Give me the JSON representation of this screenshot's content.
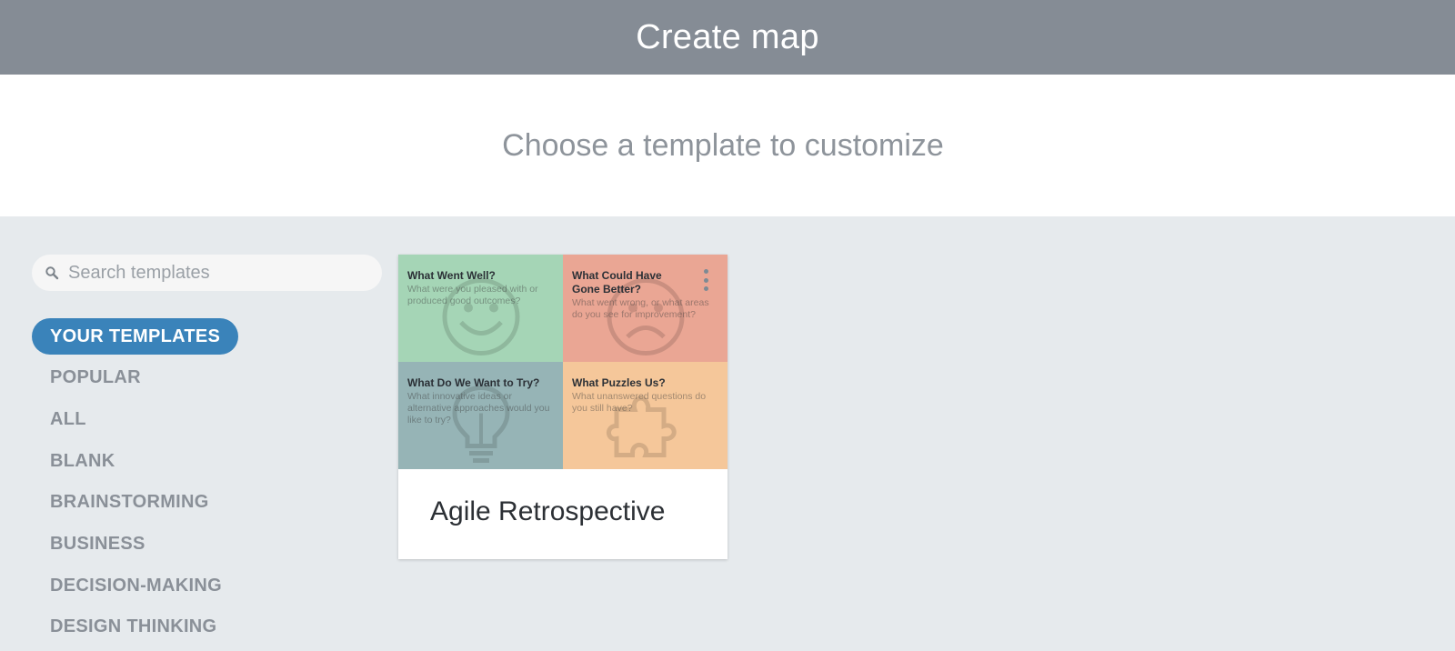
{
  "header": {
    "title": "Create map"
  },
  "subheader": {
    "title": "Choose a template to customize"
  },
  "search": {
    "placeholder": "Search templates",
    "value": ""
  },
  "categories": [
    {
      "label": "YOUR TEMPLATES",
      "active": true
    },
    {
      "label": "POPULAR"
    },
    {
      "label": "ALL"
    },
    {
      "label": "BLANK"
    },
    {
      "label": "BRAINSTORMING"
    },
    {
      "label": "BUSINESS"
    },
    {
      "label": "DECISION-MAKING"
    },
    {
      "label": "DESIGN THINKING"
    }
  ],
  "templates": [
    {
      "title": "Agile Retrospective",
      "quadrants": [
        {
          "title": "What Went Well?",
          "desc": "What were you pleased with or produced good outcomes?",
          "color": "#a5d5b6",
          "icon": "smile-icon"
        },
        {
          "title": "What Could Have Gone Better?",
          "desc": "What went wrong, or what areas do you see for improvement?",
          "color": "#eaa694",
          "icon": "frown-icon"
        },
        {
          "title": "What Do We Want to Try?",
          "desc": "What innovative ideas or alternative approaches would you like to try?",
          "color": "#96b4b6",
          "icon": "lightbulb-icon"
        },
        {
          "title": "What Puzzles Us?",
          "desc": "What unanswered questions do you still have?",
          "color": "#f5c79a",
          "icon": "puzzle-icon"
        }
      ]
    }
  ],
  "colors": {
    "header_bg": "#858c95",
    "active_category": "#3a83ba",
    "page_bg": "#e6eaed"
  }
}
